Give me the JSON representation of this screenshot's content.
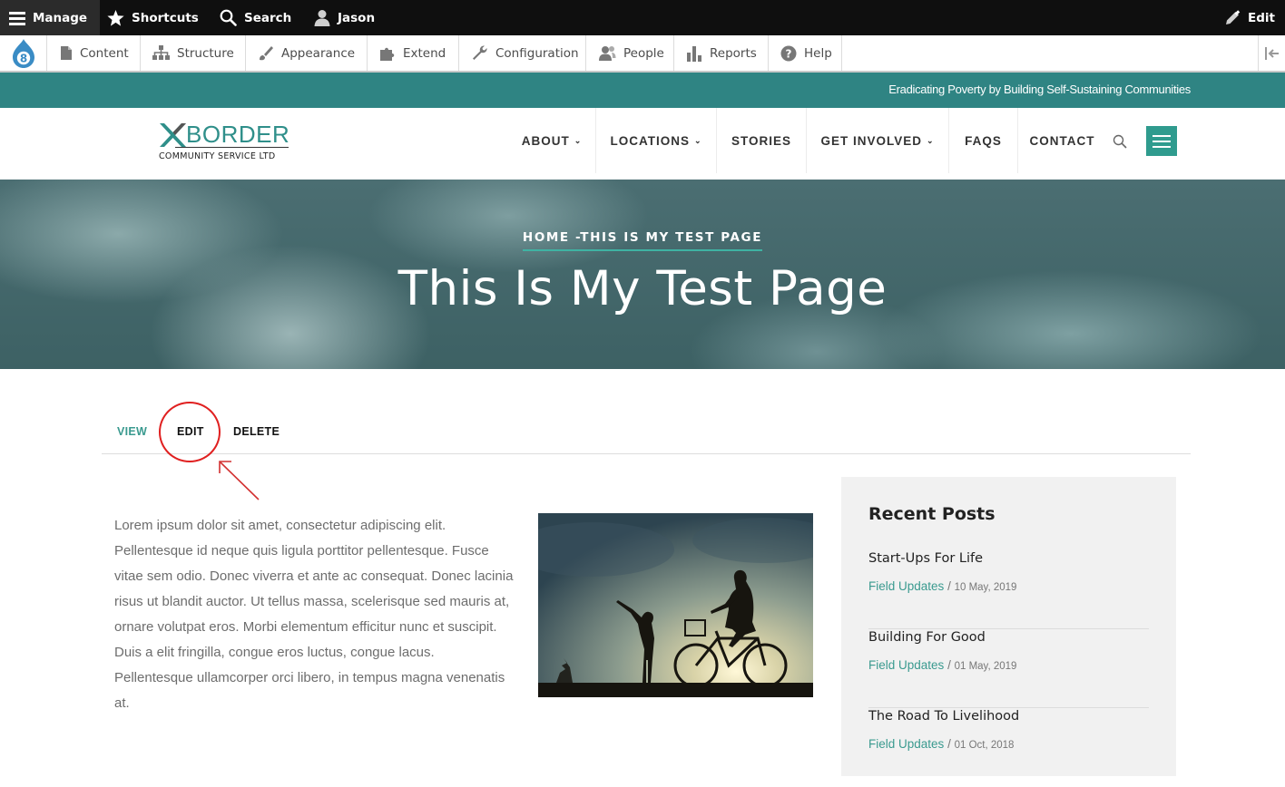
{
  "toolbar": {
    "manage": "Manage",
    "shortcuts": "Shortcuts",
    "search": "Search",
    "user": "Jason",
    "edit": "Edit"
  },
  "admin_menu": {
    "items": [
      {
        "label": "Content",
        "icon": "document-icon"
      },
      {
        "label": "Structure",
        "icon": "sitemap-icon"
      },
      {
        "label": "Appearance",
        "icon": "paintbrush-icon"
      },
      {
        "label": "Extend",
        "icon": "puzzle-icon"
      },
      {
        "label": "Configuration",
        "icon": "wrench-icon"
      },
      {
        "label": "People",
        "icon": "people-icon"
      },
      {
        "label": "Reports",
        "icon": "bar-chart-icon"
      },
      {
        "label": "Help",
        "icon": "help-icon"
      }
    ]
  },
  "site": {
    "tagline": "Eradicating Poverty by Building Self-Sustaining Communities",
    "logo_main": "BORDER",
    "logo_sub": "COMMUNITY SERVICE LTD",
    "accent_color": "#2f8483"
  },
  "nav": {
    "items": [
      {
        "label": "ABOUT",
        "has_dropdown": true
      },
      {
        "label": "LOCATIONS",
        "has_dropdown": true
      },
      {
        "label": "STORIES",
        "has_dropdown": false
      },
      {
        "label": "GET INVOLVED",
        "has_dropdown": true
      },
      {
        "label": "FAQS",
        "has_dropdown": false
      },
      {
        "label": "CONTACT",
        "has_dropdown": false
      }
    ]
  },
  "hero": {
    "breadcrumb": "HOME -THIS IS MY TEST PAGE",
    "title": "This Is My Test Page"
  },
  "tabs": {
    "view": "VIEW",
    "edit": "EDIT",
    "delete": "DELETE",
    "active": "view"
  },
  "content": {
    "body": "Lorem ipsum dolor sit amet, consectetur adipiscing elit. Pellentesque id neque quis ligula porttitor pellentesque. Fusce vitae sem odio. Donec viverra et ante ac consequat. Donec lacinia risus ut blandit auctor. Ut tellus massa, scelerisque sed mauris at, ornare volutpat eros. Morbi elementum efficitur nunc et suscipit. Duis a elit fringilla, congue eros luctus, congue lacus. Pellentesque ullamcorper orci libero, in tempus magna venenatis at."
  },
  "sidebar": {
    "title": "Recent Posts",
    "posts": [
      {
        "title": "Start-Ups For Life",
        "category": "Field Updates",
        "date": "10 May, 2019"
      },
      {
        "title": "Building For Good",
        "category": "Field Updates",
        "date": "01 May, 2019"
      },
      {
        "title": "The Road To Livelihood",
        "category": "Field Updates",
        "date": "01 Oct, 2018"
      }
    ]
  },
  "meta_sep": "/"
}
